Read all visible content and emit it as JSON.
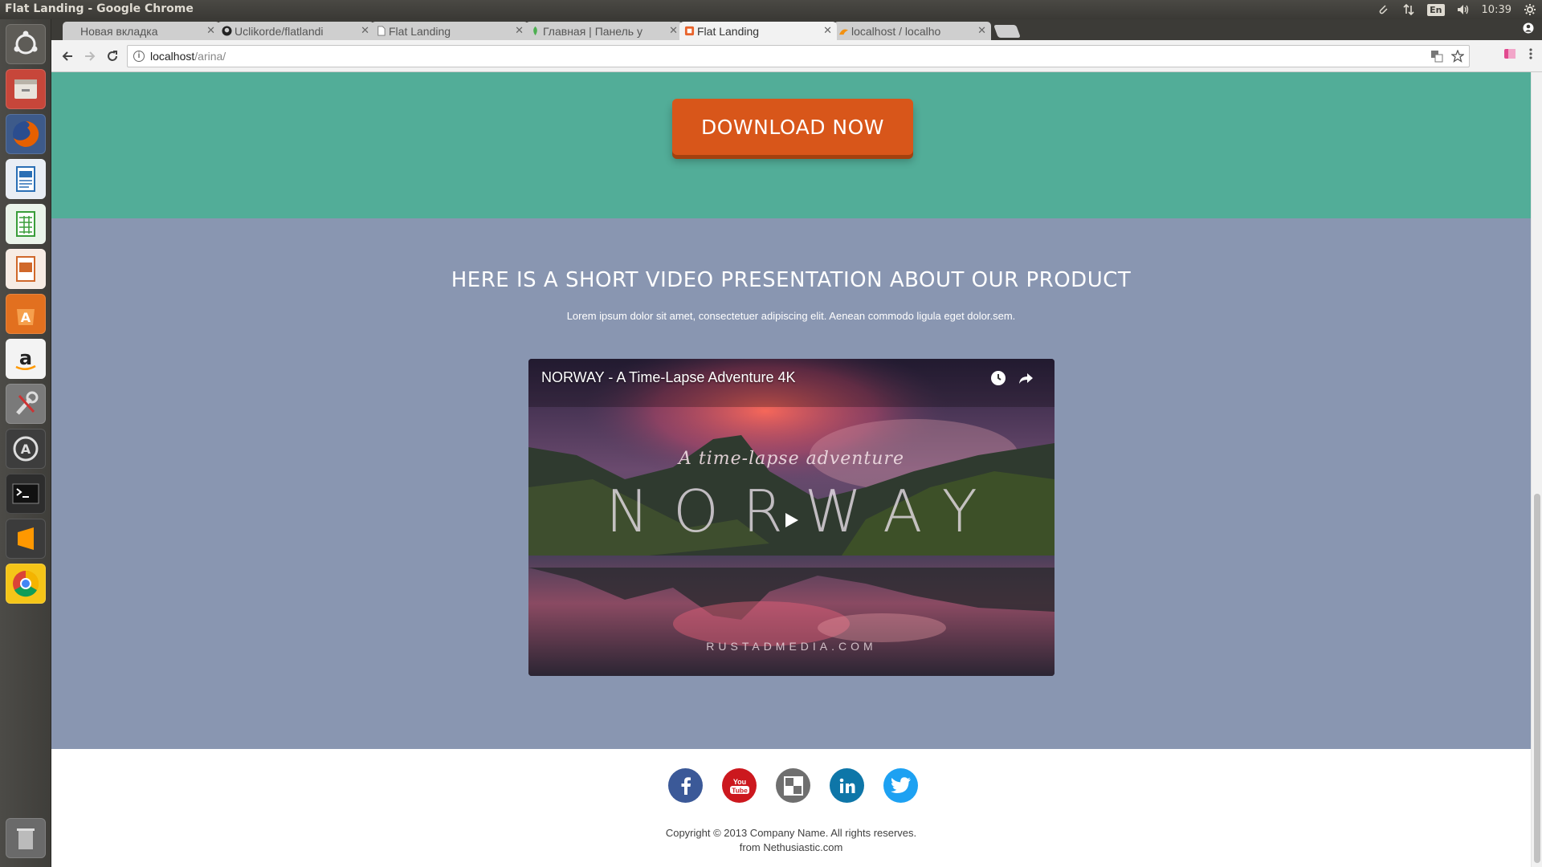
{
  "os_panel": {
    "window_title": "Flat Landing - Google Chrome",
    "keyboard_lang": "En",
    "clock": "10:39"
  },
  "launcher": {
    "items": [
      {
        "name": "ubuntu-dash-icon",
        "color": "#5e5c57"
      },
      {
        "name": "files-icon",
        "color": "#c7463a"
      },
      {
        "name": "firefox-icon",
        "color": "#e66000"
      },
      {
        "name": "writer-icon",
        "color": "#2a6fb5"
      },
      {
        "name": "calc-icon",
        "color": "#3a9d3a"
      },
      {
        "name": "impress-icon",
        "color": "#d0682a"
      },
      {
        "name": "software-center-icon",
        "color": "#e2701f"
      },
      {
        "name": "amazon-icon",
        "color": "#ffffff"
      },
      {
        "name": "system-settings-icon",
        "color": "#7a7a7a"
      },
      {
        "name": "software-updater-icon",
        "color": "#3d3d3d"
      },
      {
        "name": "terminal-icon",
        "color": "#2d2d2d"
      },
      {
        "name": "sublime-text-icon",
        "color": "#3b3b3b"
      },
      {
        "name": "chrome-icon",
        "color": "#f5c518"
      },
      {
        "name": "trash-icon",
        "color": "#6a6a6a"
      }
    ]
  },
  "browser": {
    "tabs": [
      {
        "title": "Новая вкладка",
        "active": false,
        "icon": "blank"
      },
      {
        "title": "Uclikorde/flatlandi",
        "active": false,
        "icon": "github"
      },
      {
        "title": "Flat Landing",
        "active": false,
        "icon": "page"
      },
      {
        "title": "Главная | Панель у",
        "active": false,
        "icon": "leaf"
      },
      {
        "title": "Flat Landing",
        "active": true,
        "icon": "orange"
      },
      {
        "title": "localhost / localho",
        "active": false,
        "icon": "pma"
      }
    ],
    "url_host": "localhost",
    "url_path": "/arina/"
  },
  "page": {
    "download_button": "DOWNLOAD NOW",
    "video_section": {
      "heading": "HERE IS A SHORT VIDEO PRESENTATION ABOUT OUR PRODUCT",
      "subtext": "Lorem ipsum dolor sit amet, consectetuer adipiscing elit. Aenean commodo ligula eget dolor.sem.",
      "video": {
        "title": "NORWAY - A Time-Lapse Adventure 4K",
        "tagline": "A time-lapse adventure",
        "bigword": "NORWAY",
        "credit": "RUSTADMEDIA.COM"
      }
    },
    "footer": {
      "socials": [
        {
          "name": "facebook",
          "glyph": "f",
          "color": "#3b5998"
        },
        {
          "name": "youtube",
          "glyph": "You\nTube",
          "color": "#cc181e"
        },
        {
          "name": "delicious",
          "glyph": "◫",
          "color": "#6f6f6f"
        },
        {
          "name": "linkedin",
          "glyph": "in",
          "color": "#0e76a8"
        },
        {
          "name": "twitter",
          "glyph": "🐦",
          "color": "#1da1f2"
        }
      ],
      "copyright_line1": "Copyright © 2013 Company Name. All rights reserves.",
      "copyright_line2": "from Nethusiastic.com"
    }
  },
  "colors": {
    "green_section": "#52ad98",
    "video_section": "#8996b1",
    "download_button": "#d8561a"
  }
}
